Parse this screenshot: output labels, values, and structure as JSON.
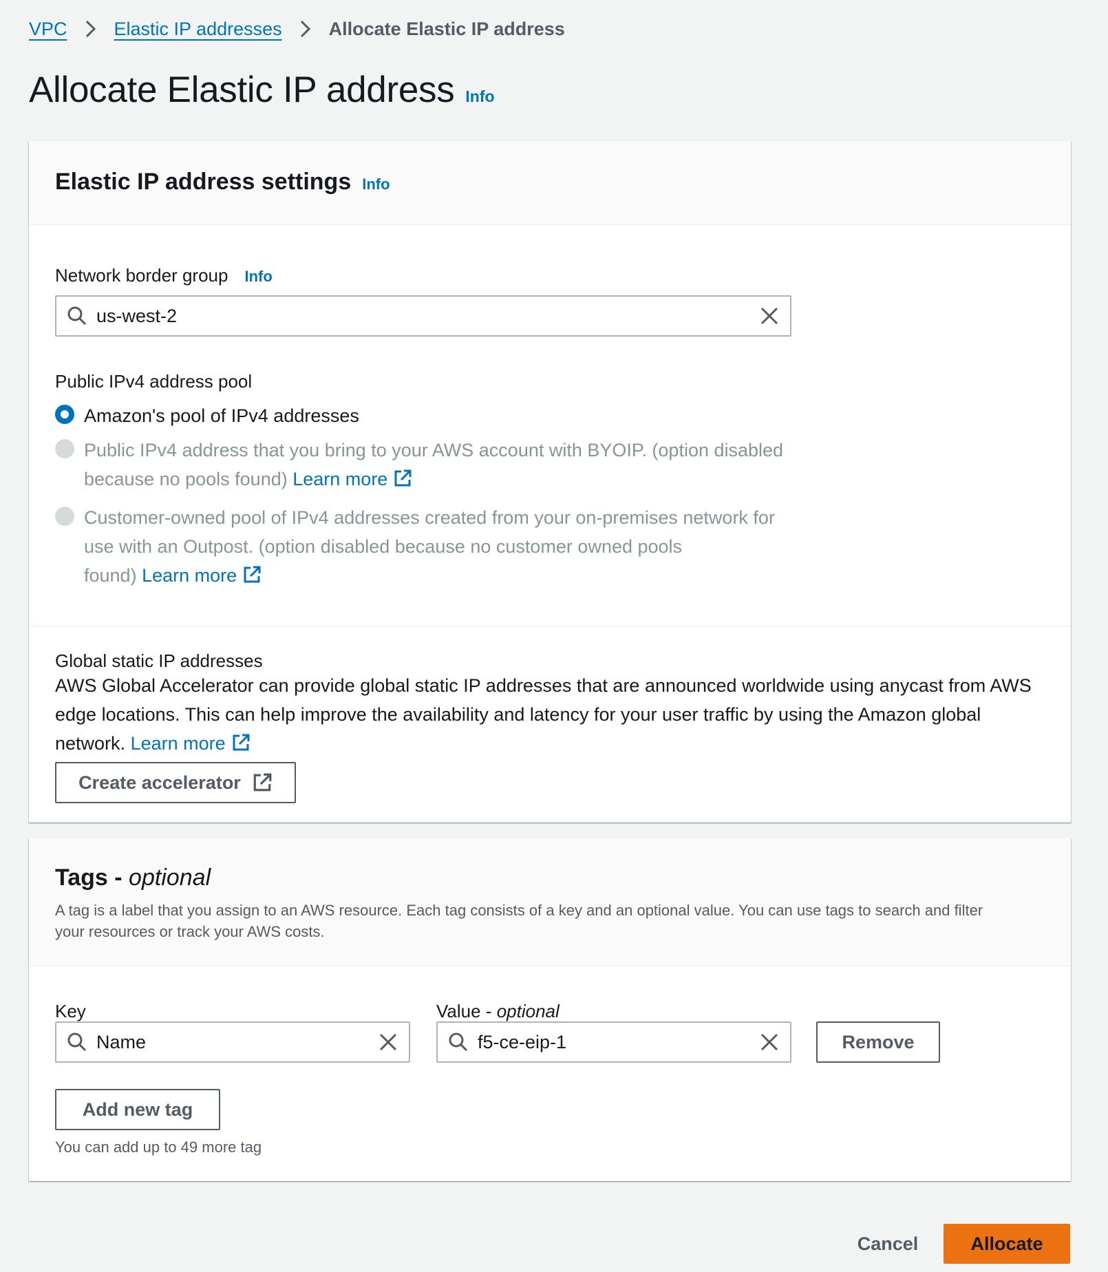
{
  "breadcrumb": {
    "items": [
      {
        "label": "VPC"
      },
      {
        "label": "Elastic IP addresses"
      }
    ],
    "current": "Allocate Elastic IP address"
  },
  "page": {
    "title": "Allocate Elastic IP address",
    "info": "Info"
  },
  "settings": {
    "title": "Elastic IP address settings",
    "info": "Info",
    "network_border_group": {
      "label": "Network border group",
      "info": "Info",
      "value": "us-west-2"
    },
    "pool": {
      "label": "Public IPv4 address pool",
      "options": [
        {
          "label": "Amazon's pool of IPv4 addresses",
          "selected": true,
          "disabled": false
        },
        {
          "label_line1": "Public IPv4 address that you bring to your AWS account with BYOIP. (option disabled",
          "label_line2": "because no pools found)",
          "link": "Learn more",
          "selected": false,
          "disabled": true
        },
        {
          "label_line1": "Customer-owned pool of IPv4 addresses created from your on-premises network for",
          "label_line2": "use with an Outpost. (option disabled because no customer owned pools",
          "label_line3": "found)",
          "link": "Learn more",
          "selected": false,
          "disabled": true
        }
      ]
    },
    "global_static": {
      "label": "Global static IP addresses",
      "desc_line1": "AWS Global Accelerator can provide global static IP addresses that are announced worldwide using anycast from AWS",
      "desc_line2": "edge locations. This can help improve the availability and latency for your user traffic by using the Amazon global",
      "desc_line3": "network.",
      "link": "Learn more",
      "button": "Create accelerator"
    }
  },
  "tags": {
    "title": "Tags - ",
    "title_optional": "optional",
    "description_line1": "A tag is a label that you assign to an AWS resource. Each tag consists of a key and an optional value. You can use tags to search and filter",
    "description_line2": "your resources or track your AWS costs.",
    "key_label": "Key",
    "value_label": "Value - ",
    "value_label_optional": "optional",
    "rows": [
      {
        "key": "Name",
        "value": "f5-ce-eip-1"
      }
    ],
    "remove_button": "Remove",
    "add_button": "Add new tag",
    "hint": "You can add up to 49 more tag"
  },
  "footer": {
    "cancel": "Cancel",
    "allocate": "Allocate"
  },
  "colors": {
    "link": "#0073bb",
    "primary_button": "#ec7211",
    "background": "#f2f3f3"
  },
  "icons": [
    "chevron-right-icon",
    "search-icon",
    "close-icon",
    "external-link-icon"
  ]
}
